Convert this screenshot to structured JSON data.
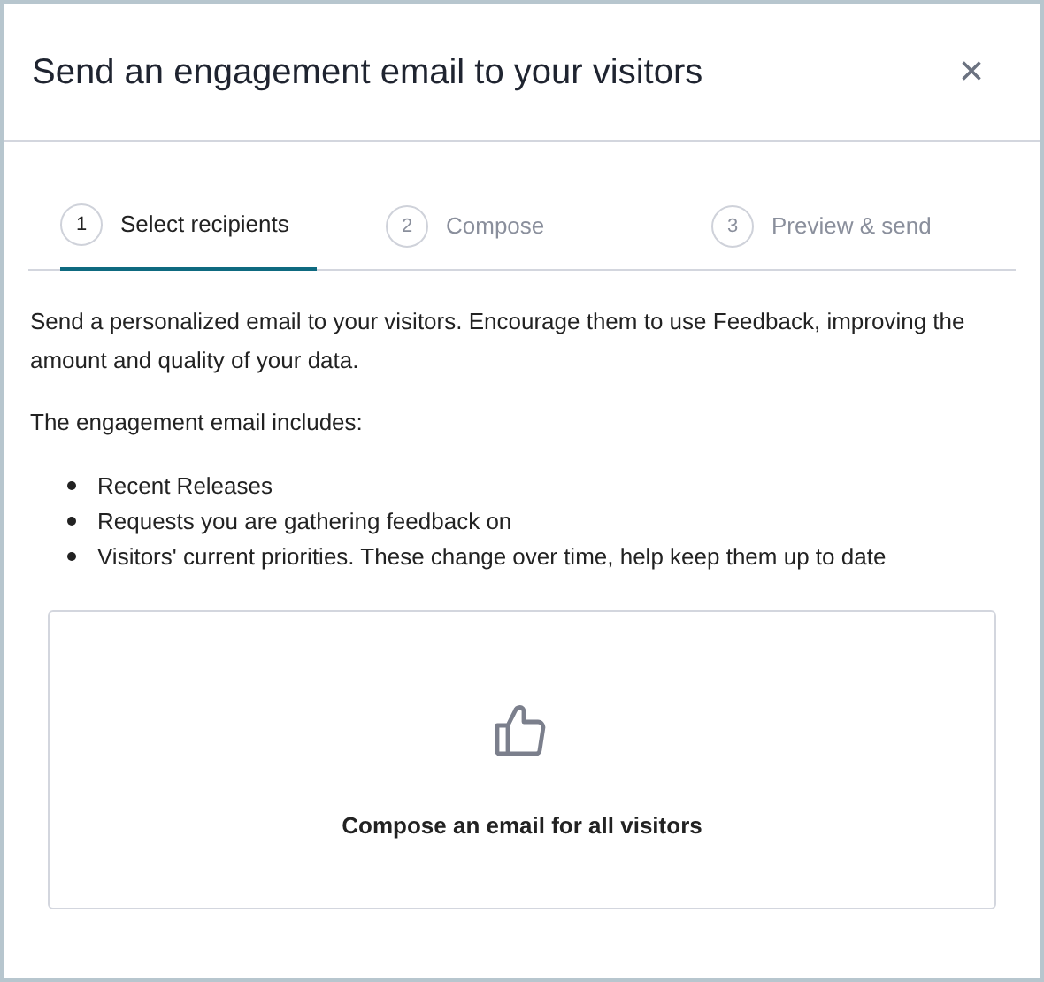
{
  "dialog": {
    "title": "Send an engagement email to your visitors",
    "close": "×"
  },
  "steps": [
    {
      "number": "1",
      "label": "Select recipients",
      "selected": true
    },
    {
      "number": "2",
      "label": "Compose",
      "selected": false
    },
    {
      "number": "3",
      "label": "Preview & send",
      "selected": false
    }
  ],
  "intro": "Send a personalized email to your visitors. Encourage them to use Feedback, improving the amount and quality of your data.",
  "includes_heading": "The engagement email includes:",
  "includes": [
    "Recent Releases",
    "Requests you are gathering feedback on",
    "Visitors' current priorities. These change over time, help keep them up to date"
  ],
  "option_card": {
    "label": "Compose an email for all visitors"
  }
}
